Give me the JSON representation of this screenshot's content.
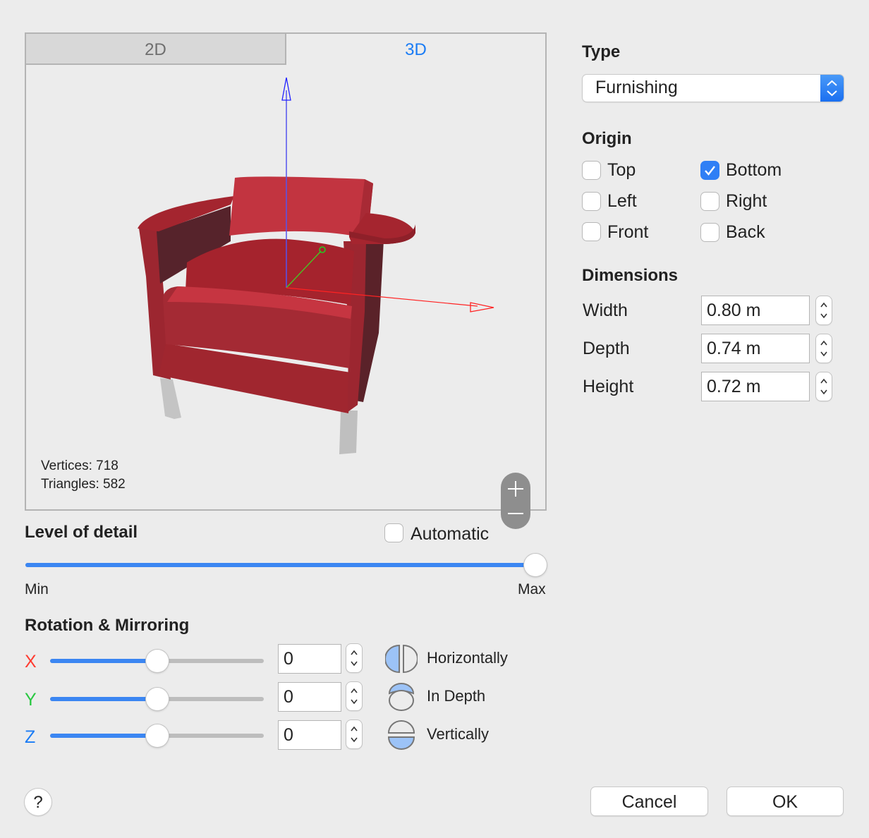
{
  "preview": {
    "tabs": [
      {
        "label": "2D",
        "selected": false
      },
      {
        "label": "3D",
        "selected": true
      }
    ],
    "stats": {
      "vertices": "Vertices: 718",
      "triangles": "Triangles: 582"
    },
    "zoom": {
      "in_icon": "plus-icon",
      "out_icon": "minus-icon"
    },
    "axes_colors": {
      "x": "#ff0000",
      "y": "#22cc22",
      "z": "#2222ff"
    },
    "model_color": "#a3252f"
  },
  "level_of_detail": {
    "heading": "Level of detail",
    "automatic_label": "Automatic",
    "automatic_checked": false,
    "min_label": "Min",
    "max_label": "Max",
    "value_fraction": 1.0
  },
  "rotation": {
    "heading": "Rotation & Mirroring",
    "axes": [
      {
        "label": "X",
        "color": "#ff3b30",
        "value": "0",
        "slider_fraction": 0.5
      },
      {
        "label": "Y",
        "color": "#28c840",
        "value": "0",
        "slider_fraction": 0.5
      },
      {
        "label": "Z",
        "color": "#1a7cf5",
        "value": "0",
        "slider_fraction": 0.5
      }
    ],
    "mirrors": [
      {
        "label": "Horizontally",
        "icon": "mirror-horizontal-icon"
      },
      {
        "label": "In Depth",
        "icon": "mirror-depth-icon"
      },
      {
        "label": "Vertically",
        "icon": "mirror-vertical-icon"
      }
    ]
  },
  "type": {
    "heading": "Type",
    "selected": "Furnishing"
  },
  "origin": {
    "heading": "Origin",
    "options": [
      {
        "label": "Top",
        "checked": false
      },
      {
        "label": "Bottom",
        "checked": true
      },
      {
        "label": "Left",
        "checked": false
      },
      {
        "label": "Right",
        "checked": false
      },
      {
        "label": "Front",
        "checked": false
      },
      {
        "label": "Back",
        "checked": false
      }
    ]
  },
  "dimensions": {
    "heading": "Dimensions",
    "fields": [
      {
        "label": "Width",
        "value": "0.80 m"
      },
      {
        "label": "Depth",
        "value": "0.74 m"
      },
      {
        "label": "Height",
        "value": "0.72 m"
      }
    ]
  },
  "footer": {
    "help_label": "?",
    "cancel_label": "Cancel",
    "ok_label": "OK"
  }
}
